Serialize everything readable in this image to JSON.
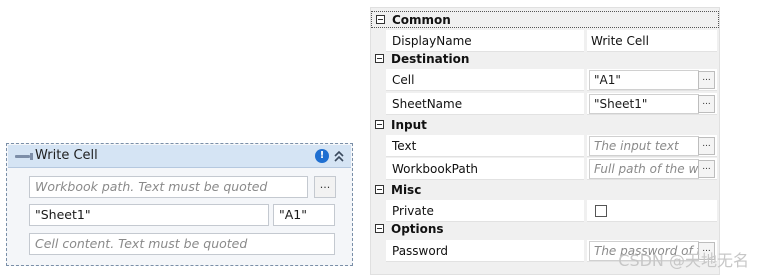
{
  "activity": {
    "title": "Write Cell",
    "workbook_placeholder": "Workbook path. Text must be quoted",
    "browse_label": "...",
    "sheet_value": "\"Sheet1\"",
    "cell_value": "\"A1\"",
    "content_placeholder": "Cell content. Text must be quoted"
  },
  "properties": {
    "categories": {
      "common": "Common",
      "destination": "Destination",
      "input": "Input",
      "misc": "Misc",
      "options": "Options"
    },
    "rows": {
      "display_name": {
        "label": "DisplayName",
        "value": "Write Cell"
      },
      "cell": {
        "label": "Cell",
        "value": "\"A1\""
      },
      "sheet_name": {
        "label": "SheetName",
        "value": "\"Sheet1\""
      },
      "text": {
        "label": "Text",
        "placeholder": "The input text"
      },
      "workbook_path": {
        "label": "WorkbookPath",
        "placeholder": "Full path of the wo"
      },
      "private": {
        "label": "Private",
        "checked": false
      },
      "password": {
        "label": "Password",
        "placeholder": "The password of th"
      }
    },
    "button_label": "..."
  },
  "watermark": "CSDN @天地无名",
  "colors": {
    "header_bg": "#d5e4f4",
    "warning": "#1f6fd1",
    "panel_bg": "#f0f0f0"
  }
}
